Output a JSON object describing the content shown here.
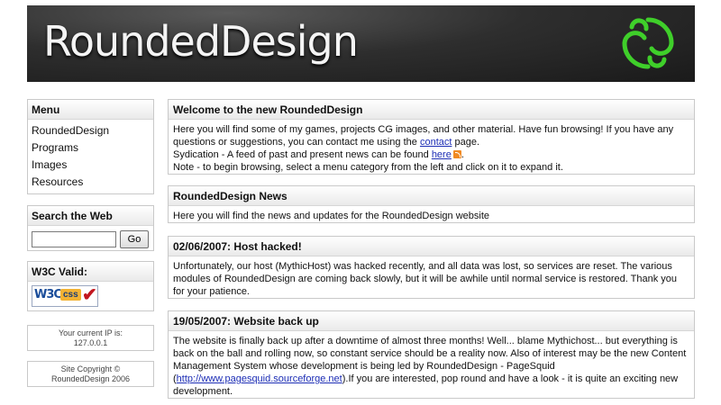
{
  "banner": {
    "title": "RoundedDesign",
    "accent": "#3fcf2a"
  },
  "menu": {
    "heading": "Menu",
    "items": [
      "RoundedDesign",
      "Programs",
      "Images",
      "Resources"
    ]
  },
  "search": {
    "heading": "Search the Web",
    "value": "",
    "button_label": "Go"
  },
  "w3c": {
    "heading": "W3C Valid:",
    "badge_w3c": "W3C",
    "badge_css": "css"
  },
  "ip": {
    "line1": "Your current IP is:",
    "line2": "127.0.0.1"
  },
  "copyright": {
    "line1": "Site Copyright ©",
    "line2": "RoundedDesign 2006"
  },
  "posts": [
    {
      "title": "Welcome to the new RoundedDesign",
      "p1_before": "Here you will find some of my games, projects CG images, and other material. Have fun browsing! If you have any questions or suggestions, you can contact me using the ",
      "p1_link": "contact",
      "p1_after": " page.",
      "p2_before": "Sydication - A feed of past and present news can be found ",
      "p2_link": "here",
      "p2_after": ".",
      "p3": "Note - to begin browsing, select a menu category from the left and click on it to expand it."
    },
    {
      "title": "RoundedDesign News",
      "body": "Here you will find the news and updates for the RoundedDesign website"
    },
    {
      "title": "02/06/2007: Host hacked!",
      "body": "Unfortunately, our host (MythicHost) was hacked recently, and all data was lost, so services are reset. The various modules of RoundedDesign are coming back slowly, but it will be awhile until normal service is restored. Thank you for your patience."
    },
    {
      "title": "19/05/2007: Website back up",
      "body_before": "The website is finally back up after a downtime of almost three months! Well... blame Mythichost... but everything is back on the ball and rolling now, so constant service should be a reality now. Also of interest may be the new Content Management System whose development is being led by RoundedDesign - PageSquid (",
      "link": "http://www.pagesquid.sourceforge.net",
      "body_after": ").If you are interested, pop round and have a look - it is quite an exciting new development."
    }
  ]
}
